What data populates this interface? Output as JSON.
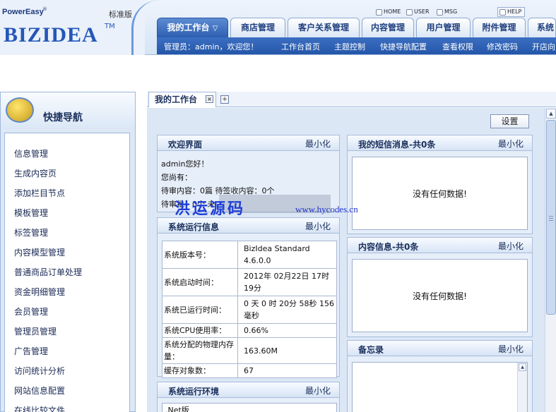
{
  "header": {
    "brand_small": "PowerEasy",
    "edition": "标准版",
    "logo_text": "BIZIDEA",
    "logo_tm": "TM",
    "top_links": [
      {
        "label": "HOME",
        "icon": "home-icon"
      },
      {
        "label": "USER",
        "icon": "user-icon"
      },
      {
        "label": "MSG",
        "icon": "mail-icon"
      },
      {
        "label": "HELP",
        "icon": "help-icon"
      }
    ],
    "nav_tabs": [
      "我的工作台",
      "商店管理",
      "客户关系管理",
      "内容管理",
      "用户管理",
      "附件管理",
      "系统"
    ],
    "active_chevron": "▽",
    "admin_label": "管理员：admin，欢迎您！",
    "sub_links": [
      "工作台首页",
      "主题控制",
      "快捷导航配置",
      "查看权限",
      "修改密码",
      "开店向"
    ]
  },
  "sidebar": {
    "title": "快捷导航",
    "items": [
      "信息管理",
      "生成内容页",
      "添加栏目节点",
      "模板管理",
      "标签管理",
      "内容模型管理",
      "普通商品订单处理",
      "资金明细管理",
      "会员管理",
      "管理员管理",
      "广告管理",
      "访问统计分析",
      "网站信息配置",
      "在线比较文件"
    ]
  },
  "tabs": {
    "current": "我的工作台",
    "close_glyph": "×",
    "add_glyph": "+"
  },
  "toolbar": {
    "settings_label": "设置"
  },
  "widgets": {
    "welcome": {
      "title": "欢迎界面",
      "minimize": "最小化",
      "lines": [
        "admin您好！",
        "您尚有：",
        "待审内容：0篇 待签收内容：0个",
        "待审批：0个 未"
      ]
    },
    "sysinfo": {
      "title": "系统运行信息",
      "minimize": "最小化",
      "rows": [
        {
          "label": "系统版本号：",
          "value": "BizIdea Standard 4.6.0.0"
        },
        {
          "label": "系统启动时间：",
          "value": "2012年 02月22日 17时19分"
        },
        {
          "label": "系统已运行时间：",
          "value": "0 天 0 时 20分 58秒 156毫秒"
        },
        {
          "label": "系统CPU使用率：",
          "value": "0.66%"
        },
        {
          "label": "系统分配的物理内存量：",
          "value": "163.60M"
        },
        {
          "label": "缓存对象数：",
          "value": "67"
        }
      ]
    },
    "sysenv": {
      "title": "系统运行环境",
      "minimize": "最小化",
      "first_line": ".Net版"
    },
    "sms": {
      "title": "我的短信消息-共0条",
      "minimize": "最小化",
      "empty": "没有任何数据!"
    },
    "content": {
      "title": "内容信息-共0条",
      "minimize": "最小化",
      "empty": "没有任何数据!"
    },
    "memo": {
      "title": "备忘录",
      "minimize": "最小化"
    }
  },
  "watermark": {
    "cn": "洪运源码",
    "en": "www.hycodes.cn"
  },
  "colors": {
    "nav_active": "#2e5fb0",
    "subbar": "#2456a8",
    "panel_bg": "#dce7f5"
  }
}
